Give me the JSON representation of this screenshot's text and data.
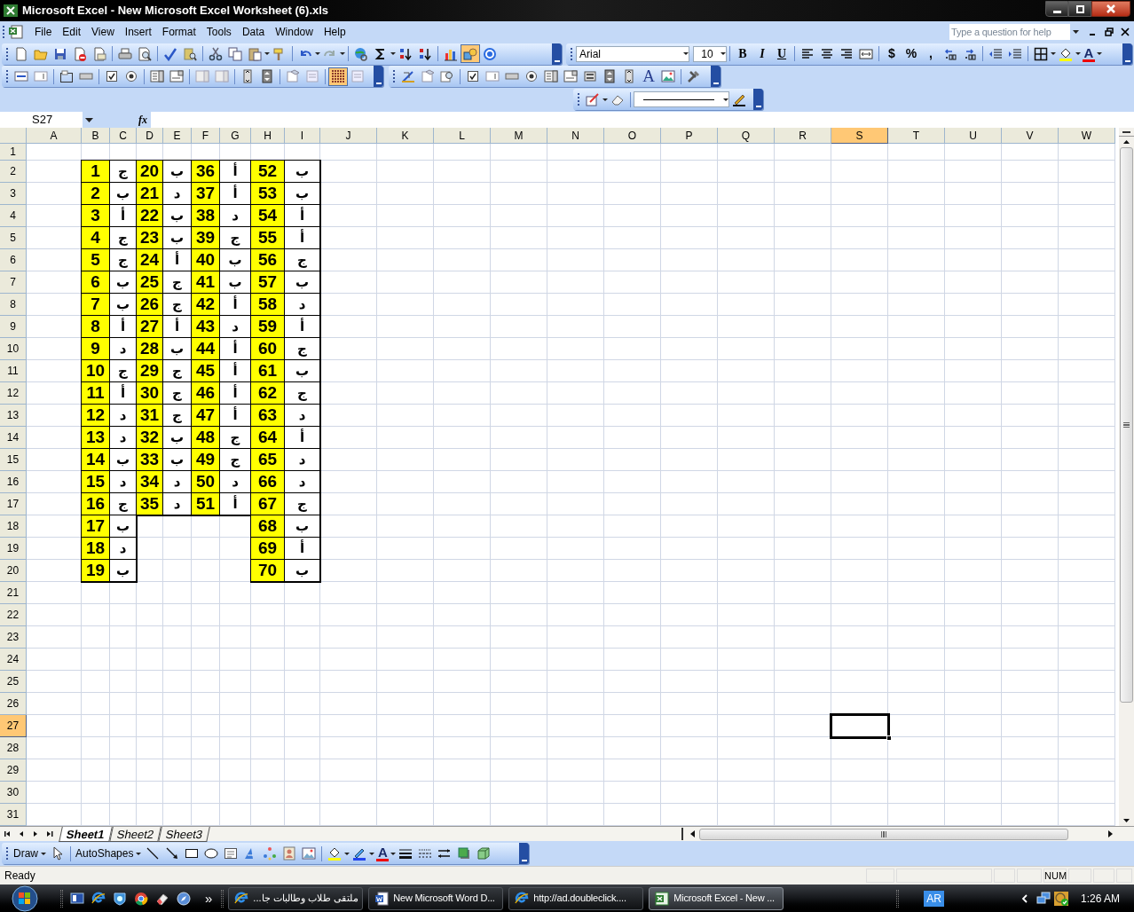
{
  "window": {
    "title": "Microsoft Excel - New Microsoft Excel Worksheet (6).xls"
  },
  "menu": [
    "File",
    "Edit",
    "View",
    "Insert",
    "Format",
    "Tools",
    "Data",
    "Window",
    "Help"
  ],
  "help_box": {
    "placeholder": "Type a question for help"
  },
  "formatting": {
    "font": "Arial",
    "size": "10",
    "bold": "B",
    "italic": "I",
    "underline": "U",
    "currency": "$",
    "percent": "%",
    "comma": ",",
    "font_color": "A"
  },
  "control_toolbox": {
    "label_control": "A"
  },
  "formula_bar": {
    "name_box": "S27",
    "function_label": "fx"
  },
  "sheet": {
    "columns": [
      {
        "label": "A",
        "selected": false
      },
      {
        "label": "B",
        "selected": false
      },
      {
        "label": "C",
        "selected": false
      },
      {
        "label": "D",
        "selected": false
      },
      {
        "label": "E",
        "selected": false
      },
      {
        "label": "F",
        "selected": false
      },
      {
        "label": "G",
        "selected": false
      },
      {
        "label": "H",
        "selected": false
      },
      {
        "label": "I",
        "selected": false
      },
      {
        "label": "J",
        "selected": false
      },
      {
        "label": "K",
        "selected": false
      },
      {
        "label": "L",
        "selected": false
      },
      {
        "label": "M",
        "selected": false
      },
      {
        "label": "N",
        "selected": false
      },
      {
        "label": "O",
        "selected": false
      },
      {
        "label": "P",
        "selected": false
      },
      {
        "label": "Q",
        "selected": false
      },
      {
        "label": "R",
        "selected": false
      },
      {
        "label": "S",
        "selected": true
      },
      {
        "label": "T",
        "selected": false
      },
      {
        "label": "U",
        "selected": false
      },
      {
        "label": "V",
        "selected": false
      },
      {
        "label": "W",
        "selected": false
      }
    ],
    "rows": [
      {
        "label": "1",
        "selected": false
      },
      {
        "label": "2",
        "selected": false,
        "cells": [
          null,
          "1",
          "ج",
          "20",
          "ب",
          "36",
          "أ",
          "52",
          "ب"
        ]
      },
      {
        "label": "3",
        "selected": false,
        "cells": [
          null,
          "2",
          "ب",
          "21",
          "د",
          "37",
          "أ",
          "53",
          "ب"
        ]
      },
      {
        "label": "4",
        "selected": false,
        "cells": [
          null,
          "3",
          "أ",
          "22",
          "ب",
          "38",
          "د",
          "54",
          "أ"
        ]
      },
      {
        "label": "5",
        "selected": false,
        "cells": [
          null,
          "4",
          "ج",
          "23",
          "ب",
          "39",
          "ج",
          "55",
          "أ"
        ]
      },
      {
        "label": "6",
        "selected": false,
        "cells": [
          null,
          "5",
          "ج",
          "24",
          "أ",
          "40",
          "ب",
          "56",
          "ج"
        ]
      },
      {
        "label": "7",
        "selected": false,
        "cells": [
          null,
          "6",
          "ب",
          "25",
          "ج",
          "41",
          "ب",
          "57",
          "ب"
        ]
      },
      {
        "label": "8",
        "selected": false,
        "cells": [
          null,
          "7",
          "ب",
          "26",
          "ج",
          "42",
          "أ",
          "58",
          "د"
        ]
      },
      {
        "label": "9",
        "selected": false,
        "cells": [
          null,
          "8",
          "أ",
          "27",
          "أ",
          "43",
          "د",
          "59",
          "أ"
        ]
      },
      {
        "label": "10",
        "selected": false,
        "cells": [
          null,
          "9",
          "د",
          "28",
          "ب",
          "44",
          "أ",
          "60",
          "ج"
        ]
      },
      {
        "label": "11",
        "selected": false,
        "cells": [
          null,
          "10",
          "ج",
          "29",
          "ج",
          "45",
          "أ",
          "61",
          "ب"
        ]
      },
      {
        "label": "12",
        "selected": false,
        "cells": [
          null,
          "11",
          "أ",
          "30",
          "ج",
          "46",
          "أ",
          "62",
          "ج"
        ]
      },
      {
        "label": "13",
        "selected": false,
        "cells": [
          null,
          "12",
          "د",
          "31",
          "ج",
          "47",
          "أ",
          "63",
          "د"
        ]
      },
      {
        "label": "14",
        "selected": false,
        "cells": [
          null,
          "13",
          "د",
          "32",
          "ب",
          "48",
          "ج",
          "64",
          "أ"
        ]
      },
      {
        "label": "15",
        "selected": false,
        "cells": [
          null,
          "14",
          "ب",
          "33",
          "ب",
          "49",
          "ج",
          "65",
          "د"
        ]
      },
      {
        "label": "16",
        "selected": false,
        "cells": [
          null,
          "15",
          "د",
          "34",
          "د",
          "50",
          "د",
          "66",
          "د"
        ]
      },
      {
        "label": "17",
        "selected": false,
        "cells": [
          null,
          "16",
          "ج",
          "35",
          "د",
          "51",
          "أ",
          "67",
          "ج"
        ]
      },
      {
        "label": "18",
        "selected": false,
        "cells": [
          null,
          "17",
          "ب",
          null,
          null,
          null,
          null,
          "68",
          "ب"
        ]
      },
      {
        "label": "19",
        "selected": false,
        "cells": [
          null,
          "18",
          "د",
          null,
          null,
          null,
          null,
          "69",
          "أ"
        ]
      },
      {
        "label": "20",
        "selected": false,
        "cells": [
          null,
          "19",
          "ب",
          null,
          null,
          null,
          null,
          "70",
          "ب"
        ]
      },
      {
        "label": "21",
        "selected": false
      },
      {
        "label": "22",
        "selected": false
      },
      {
        "label": "23",
        "selected": false
      },
      {
        "label": "24",
        "selected": false
      },
      {
        "label": "25",
        "selected": false
      },
      {
        "label": "26",
        "selected": false
      },
      {
        "label": "27",
        "selected": true
      },
      {
        "label": "28",
        "selected": false
      },
      {
        "label": "29",
        "selected": false
      },
      {
        "label": "30",
        "selected": false
      },
      {
        "label": "31",
        "selected": false
      }
    ]
  },
  "sheet_tabs": [
    {
      "label": "Sheet1",
      "selected": true
    },
    {
      "label": "Sheet2",
      "selected": false
    },
    {
      "label": "Sheet3",
      "selected": false
    }
  ],
  "drawing_toolbar": {
    "draw": "Draw",
    "autoshapes": "AutoShapes",
    "font_color": "A"
  },
  "status_bar": {
    "status": "Ready",
    "num": "NUM"
  },
  "taskbar": {
    "chevron": "»",
    "tasks": [
      {
        "kind": "browser",
        "label": "ملتقى طلاب وطالبات جا...",
        "selected": false
      },
      {
        "kind": "word",
        "label": "New Microsoft Word D...",
        "selected": false
      },
      {
        "kind": "browser",
        "label": "http://ad.doubleclick....",
        "selected": false
      },
      {
        "kind": "excel",
        "label": "Microsoft Excel - New ...",
        "selected": true
      }
    ],
    "language": "AR",
    "clock": "1:26 AM"
  }
}
